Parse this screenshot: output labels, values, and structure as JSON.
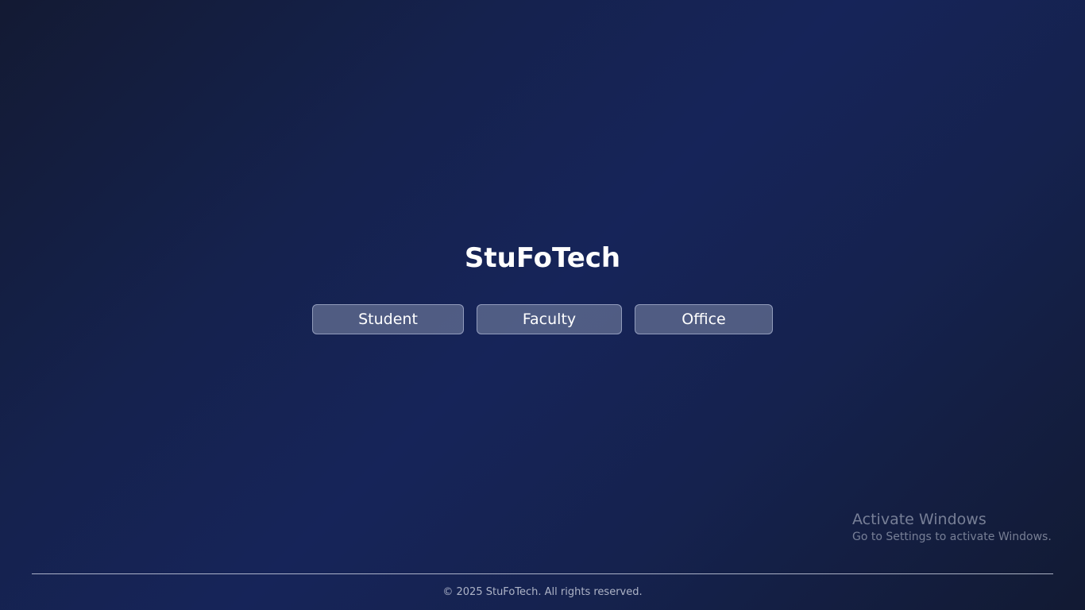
{
  "app": {
    "title": "StuFoTech"
  },
  "roles": {
    "student_label": "Student",
    "faculty_label": "Faculty",
    "office_label": "Office"
  },
  "watermark": {
    "title": "Activate Windows",
    "subtitle": "Go to Settings to activate Windows."
  },
  "footer": {
    "copyright": "© 2025 StuFoTech. All rights reserved."
  },
  "colors": {
    "background_dark": "#131a33",
    "background_mid": "#162459",
    "button_fill": "#5c6585",
    "text_primary": "#ffffff"
  }
}
